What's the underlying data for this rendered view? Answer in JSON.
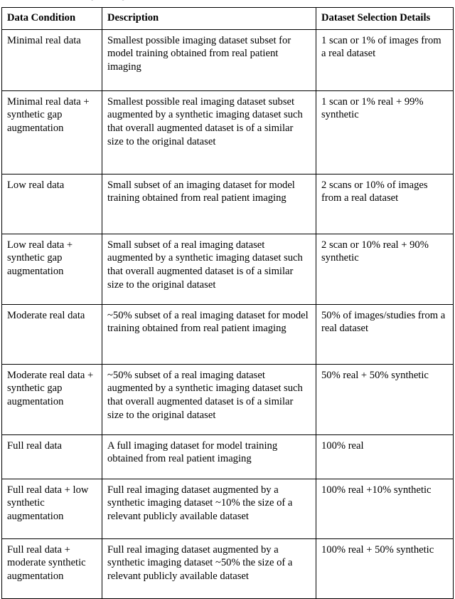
{
  "table": {
    "name": "data-condition-definitions",
    "columns": [
      {
        "key": "data_condition",
        "label": "Data Condition"
      },
      {
        "key": "description",
        "label": "Description"
      },
      {
        "key": "dataset_selection_details",
        "label": "Dataset Selection Details"
      }
    ],
    "rows": [
      {
        "data_condition": "Minimal real data",
        "description": "Smallest possible imaging dataset subset for model training obtained from real patient imaging",
        "dataset_selection_details": "1 scan or 1% of images from a real dataset"
      },
      {
        "data_condition": "Minimal real data + synthetic gap augmentation",
        "description": "Smallest possible real imaging dataset subset augmented by a synthetic imaging dataset such that overall augmented dataset is of a similar size to the original dataset",
        "dataset_selection_details": "1 scan or 1% real + 99% synthetic"
      },
      {
        "data_condition": "Low real data",
        "description": "Small subset of an imaging dataset for model training obtained from real patient imaging",
        "dataset_selection_details": "2 scans or 10% of images from a real dataset"
      },
      {
        "data_condition": "Low real data + synthetic gap augmentation",
        "description": "Small subset of a real imaging dataset augmented by a synthetic imaging dataset such that overall augmented dataset is of a similar size to the original dataset",
        "dataset_selection_details": "2 scan or 10% real + 90% synthetic"
      },
      {
        "data_condition": "Moderate real data",
        "description": "~50% subset of a real imaging dataset for model training obtained from real patient imaging",
        "dataset_selection_details": "50% of images/studies from a real dataset"
      },
      {
        "data_condition": "Moderate real data + synthetic gap augmentation",
        "description": "~50% subset of a real imaging dataset augmented by a synthetic imaging dataset such that overall augmented dataset is of a similar size to the original dataset",
        "dataset_selection_details": "50% real + 50% synthetic"
      },
      {
        "data_condition": "Full real data",
        "description": "A full imaging dataset for model training obtained from real patient imaging",
        "dataset_selection_details": "100% real"
      },
      {
        "data_condition": "Full real data + low synthetic augmentation",
        "description": "Full real imaging dataset augmented by a synthetic imaging dataset ~10% the size of a relevant publicly available dataset",
        "dataset_selection_details": "100% real +10% synthetic"
      },
      {
        "data_condition": "Full real data + moderate synthetic augmentation",
        "description": "Full real imaging dataset augmented by a synthetic imaging dataset ~50% the size of a relevant publicly available dataset",
        "dataset_selection_details": "100% real + 50% synthetic"
      }
    ]
  },
  "style": {
    "text_color": "#000000",
    "border_color": "#000000",
    "background_color": "#ffffff"
  }
}
